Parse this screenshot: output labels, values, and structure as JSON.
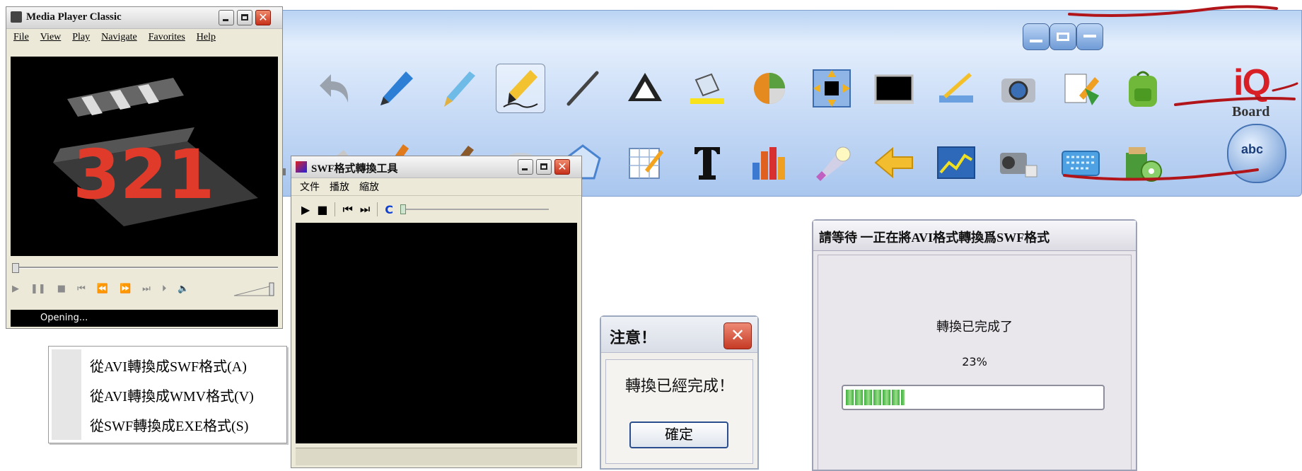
{
  "mpc": {
    "title": "Media Player Classic",
    "menu": [
      "File",
      "View",
      "Play",
      "Navigate",
      "Favorites",
      "Help"
    ],
    "video_logo_text": "321",
    "status": "Opening..."
  },
  "swf_tool": {
    "title": "SWF格式轉換工具",
    "menu": [
      "文件",
      "播放",
      "縮放"
    ],
    "controls": {
      "play": "▶",
      "stop": "■",
      "prev": "⏮",
      "next": "⏭",
      "reload": "C"
    }
  },
  "context_menu": {
    "items": [
      "從AVI轉換成SWF格式(A)",
      "從AVI轉換成WMV格式(V)",
      "從SWF轉換成EXE格式(S)"
    ]
  },
  "notice_dialog": {
    "title": "注意！",
    "message": "轉換已經完成！",
    "ok_label": "確定"
  },
  "progress_dialog": {
    "title": "請等待 一正在將AVI格式轉換爲SWF格式",
    "message": "轉換已完成了",
    "percent_label": "23%",
    "progress_fraction": 0.23
  },
  "toolbar": {
    "logo_iq": "iQ",
    "logo_board": "Board",
    "abc_label": "abc",
    "tools_row1": [
      "select-arrow-icon",
      "undo-icon",
      "pen-icon",
      "brush-pen-icon",
      "highlighter-icon",
      "line-icon",
      "triangle-icon",
      "paint-bucket-icon",
      "pie-chart-icon",
      "screen-area-icon",
      "screen-black-icon",
      "ruler-edit-icon",
      "camera-icon",
      "document-pen-icon",
      "backpack-icon"
    ],
    "tools_row2": [
      "stamp-icon",
      "marker-icon",
      "brush-icon",
      "crayon-icon",
      "eraser-icon",
      "pentagon-icon",
      "note-edit-icon",
      "text-tool-icon",
      "bar-chart-icon",
      "spotlight-icon",
      "back-arrow-icon",
      "line-graph-icon",
      "video-camera-icon",
      "keyboard-icon",
      "media-disc-icon"
    ]
  },
  "colors": {
    "toolbar_bg": "#cfe0f8",
    "xp_close": "#c7301a",
    "progress_green": "#3eae3e",
    "ink_red": "#b1151a"
  }
}
